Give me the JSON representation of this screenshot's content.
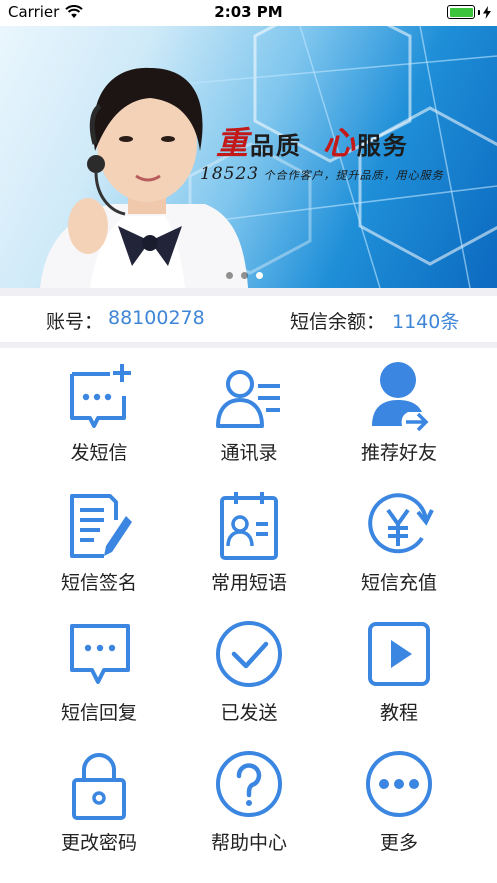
{
  "status_bar": {
    "carrier": "Carrier",
    "time": "2:03 PM"
  },
  "banner": {
    "slogan_accent_1": "重",
    "slogan_1": "品质",
    "slogan_accent_2": "心",
    "slogan_2": "服务",
    "sub_number": "18523",
    "sub_text": "个合作客户，提升品质，用心服务",
    "slides": 3,
    "active_slide": 3
  },
  "account": {
    "account_label": "账号：",
    "account_value": "88100278",
    "balance_label": "短信余额：",
    "balance_value": "1140条"
  },
  "grid": [
    {
      "label": "发短信",
      "icon": "compose-sms-icon"
    },
    {
      "label": "通讯录",
      "icon": "contacts-icon"
    },
    {
      "label": "推荐好友",
      "icon": "share-user-icon"
    },
    {
      "label": "短信签名",
      "icon": "signature-icon"
    },
    {
      "label": "常用短语",
      "icon": "clipboard-card-icon"
    },
    {
      "label": "短信充值",
      "icon": "yuan-recharge-icon"
    },
    {
      "label": "短信回复",
      "icon": "reply-bubble-icon"
    },
    {
      "label": "已发送",
      "icon": "check-circle-icon"
    },
    {
      "label": "教程",
      "icon": "play-icon"
    },
    {
      "label": "更改密码",
      "icon": "lock-icon"
    },
    {
      "label": "帮助中心",
      "icon": "help-icon"
    },
    {
      "label": "更多",
      "icon": "more-icon"
    }
  ],
  "colors": {
    "accent": "#3f86d6",
    "icon_blue": "#3a86e0",
    "banner_red": "#c41919"
  }
}
